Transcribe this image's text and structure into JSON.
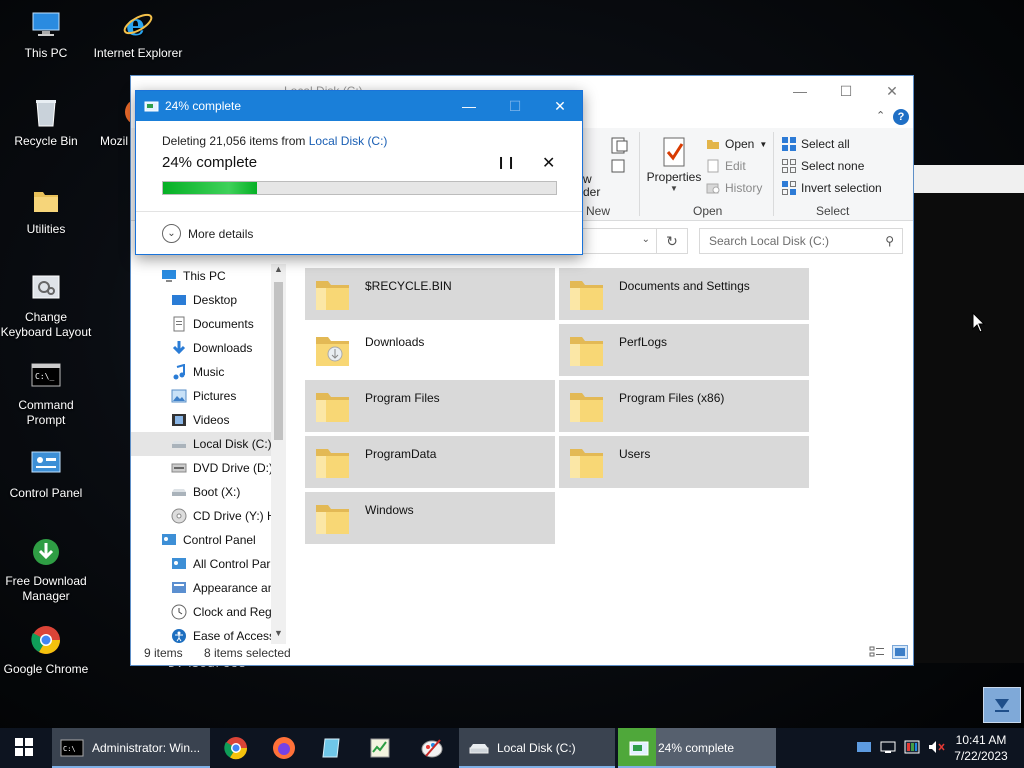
{
  "desktop": {
    "icons": [
      {
        "label": "This PC",
        "icon": "this-pc-icon"
      },
      {
        "label": "Internet Explorer",
        "icon": "internet-explorer-icon"
      },
      {
        "label": "Recycle Bin",
        "icon": "recycle-bin-icon"
      },
      {
        "label": "Mozil",
        "icon": "firefox-icon"
      },
      {
        "label": "Utilities",
        "icon": "folder-icon"
      },
      {
        "label": "Change Keyboard Layout",
        "icon": "keyboard-layout-icon"
      },
      {
        "label": "Command Prompt",
        "icon": "command-prompt-icon"
      },
      {
        "label": "Control Panel",
        "icon": "control-panel-icon"
      },
      {
        "label": "Free Download Manager",
        "icon": "free-download-manager-icon"
      },
      {
        "label": "Google Chrome",
        "icon": "chrome-icon"
      }
    ],
    "cmd_text": "D:\\Sources>"
  },
  "explorer": {
    "title": "Local Disk (C:)",
    "ribbon": {
      "new_group": {
        "label": "New",
        "partial_text": "w",
        "partial_text2": "der"
      },
      "open_group": {
        "label": "Open",
        "properties": "Properties",
        "open": "Open",
        "edit": "Edit",
        "history": "History"
      },
      "select_group": {
        "label": "Select",
        "select_all": "Select all",
        "select_none": "Select none",
        "invert_selection": "Invert selection"
      }
    },
    "search_placeholder": "Search Local Disk (C:)",
    "nav": [
      {
        "label": "This PC",
        "indent": 0,
        "icon": "this-pc-icon"
      },
      {
        "label": "Desktop",
        "indent": 1,
        "icon": "desktop-icon"
      },
      {
        "label": "Documents",
        "indent": 1,
        "icon": "documents-icon"
      },
      {
        "label": "Downloads",
        "indent": 1,
        "icon": "downloads-icon"
      },
      {
        "label": "Music",
        "indent": 1,
        "icon": "music-icon"
      },
      {
        "label": "Pictures",
        "indent": 1,
        "icon": "pictures-icon"
      },
      {
        "label": "Videos",
        "indent": 1,
        "icon": "videos-icon"
      },
      {
        "label": "Local Disk (C:)",
        "indent": 1,
        "icon": "drive-icon",
        "selected": true
      },
      {
        "label": "DVD Drive (D:)",
        "indent": 1,
        "icon": "dvd-drive-icon"
      },
      {
        "label": "Boot (X:)",
        "indent": 1,
        "icon": "drive-icon"
      },
      {
        "label": "CD Drive (Y:) H",
        "indent": 1,
        "icon": "cd-drive-icon"
      },
      {
        "label": "Control Panel",
        "indent": 0,
        "icon": "control-panel-icon"
      },
      {
        "label": "All Control Par",
        "indent": 1,
        "icon": "control-panel-icon"
      },
      {
        "label": "Appearance an",
        "indent": 1,
        "icon": "appearance-icon"
      },
      {
        "label": "Clock and Regi",
        "indent": 1,
        "icon": "clock-icon"
      },
      {
        "label": "Ease of Access",
        "indent": 1,
        "icon": "ease-of-access-icon"
      }
    ],
    "folders": [
      {
        "name": "$RECYCLE.BIN",
        "selected": true
      },
      {
        "name": "Documents and Settings",
        "selected": true
      },
      {
        "name": "Downloads",
        "selected": false
      },
      {
        "name": "PerfLogs",
        "selected": true
      },
      {
        "name": "Program Files",
        "selected": true
      },
      {
        "name": "Program Files (x86)",
        "selected": true
      },
      {
        "name": "ProgramData",
        "selected": true
      },
      {
        "name": "Users",
        "selected": true
      },
      {
        "name": "Windows",
        "selected": true
      }
    ],
    "status": {
      "items": "9 items",
      "selected": "8 items selected"
    }
  },
  "dialog": {
    "title": "24% complete",
    "line_prefix": "Deleting 21,056 items from",
    "line_link": "Local Disk (C:)",
    "percent_text": "24% complete",
    "progress": 0.24,
    "more_details": "More details"
  },
  "taskbar": {
    "items": [
      {
        "label": "Administrator: Win...",
        "icon": "command-prompt-icon"
      },
      {
        "label": "",
        "icon": "chrome-icon"
      },
      {
        "label": "",
        "icon": "firefox-icon"
      },
      {
        "label": "",
        "icon": "notepad-icon"
      },
      {
        "label": "",
        "icon": "task-manager-icon"
      },
      {
        "label": "",
        "icon": "paint-icon"
      },
      {
        "label": "Local Disk (C:)",
        "icon": "drive-icon"
      },
      {
        "label": "24% complete",
        "icon": "file-operation-icon"
      }
    ],
    "clock_time": "10:41 AM",
    "clock_date": "7/22/2023"
  },
  "colors": {
    "accent": "#1a7fd9",
    "progress": "#06b025",
    "taskbar": "#0d1420"
  }
}
